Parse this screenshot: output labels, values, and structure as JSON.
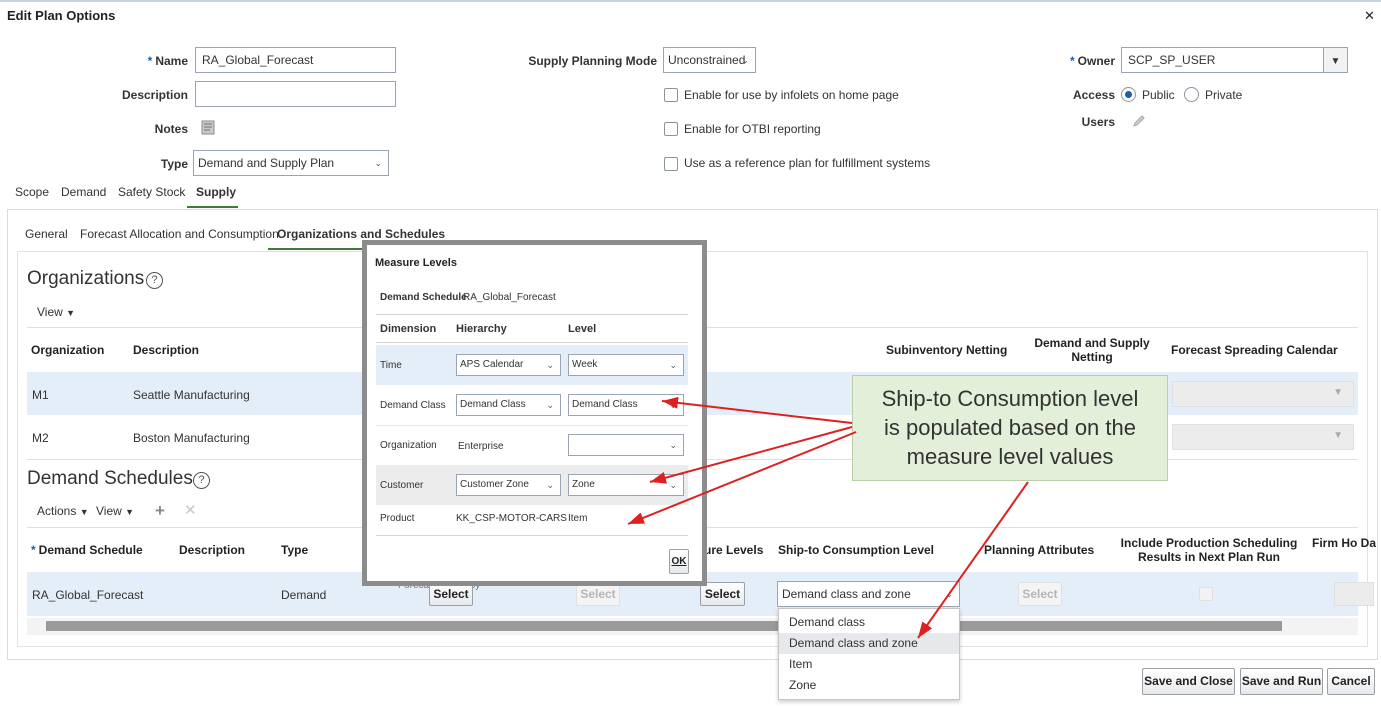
{
  "dialog": {
    "title": "Edit Plan Options",
    "close_glyph": "✕"
  },
  "form": {
    "name_label": "Name",
    "name_value": "RA_Global_Forecast",
    "description_label": "Description",
    "description_value": "",
    "notes_label": "Notes",
    "type_label": "Type",
    "type_value": "Demand and Supply Plan",
    "supply_mode_label": "Supply Planning Mode",
    "supply_mode_value": "Unconstrained",
    "check_infolets": "Enable for use by infolets on home page",
    "check_otbi": "Enable for OTBI reporting",
    "check_reference": "Use as a reference plan for fulfillment systems",
    "owner_label": "Owner",
    "owner_value": "SCP_SP_USER",
    "access_label": "Access",
    "access_public": "Public",
    "access_private": "Private",
    "access_selected": "Public",
    "users_label": "Users",
    "required_marker": "*"
  },
  "main_tabs": [
    "Scope",
    "Demand",
    "Safety Stock",
    "Supply"
  ],
  "sub_tabs": [
    "General",
    "Forecast Allocation and Consumption",
    "Organizations and Schedules"
  ],
  "organizations": {
    "title": "Organizations",
    "view_label": "View",
    "columns": {
      "organization": "Organization",
      "description": "Description",
      "subinventory": "Subinventory Netting",
      "ds_netting": "Demand and Supply Netting",
      "spreading": "Forecast Spreading Calendar"
    },
    "rows": [
      {
        "org": "M1",
        "desc": "Seattle Manufacturing"
      },
      {
        "org": "M2",
        "desc": "Boston Manufacturing"
      }
    ]
  },
  "schedules": {
    "title": "Demand Schedules",
    "actions_label": "Actions",
    "view_label": "View",
    "columns": {
      "schedule": "Demand Schedule",
      "description": "Description",
      "type": "Type",
      "measure_levels": "ure Levels",
      "ship_to": "Ship-to Consumption Level",
      "planning_attrs": "Planning Attributes",
      "include_prod": "Include Production Scheduling Results in Next Plan Run",
      "firm_ho": "Firm Ho Da"
    },
    "row": {
      "name": "RA_Global_Forecast",
      "type": "Demand",
      "fa_hint": "Forecast Accuracy",
      "select_label": "Select",
      "ship_to_value": "Demand class and zone"
    },
    "dropdown_options": [
      "Demand class",
      "Demand class and zone",
      "Item",
      "Zone"
    ],
    "dropdown_highlight": "Demand class and zone"
  },
  "measure_levels": {
    "title": "Measure Levels",
    "schedule_label": "Demand Schedule",
    "schedule_value": "RA_Global_Forecast",
    "col_dimension": "Dimension",
    "col_hierarchy": "Hierarchy",
    "col_level": "Level",
    "rows": [
      {
        "dimension": "Time",
        "hierarchy": "APS Calendar",
        "level": "Week"
      },
      {
        "dimension": "Demand Class",
        "hierarchy": "Demand Class",
        "level": "Demand Class"
      },
      {
        "dimension": "Organization",
        "hierarchy": "Enterprise",
        "level": ""
      },
      {
        "dimension": "Customer",
        "hierarchy": "Customer Zone",
        "level": "Zone"
      },
      {
        "dimension": "Product",
        "hierarchy": "KK_CSP-MOTOR-CARS",
        "level": "Item"
      }
    ],
    "ok_label": "OK"
  },
  "callout": {
    "lines": [
      "Ship-to Consumption level",
      "is populated based on the",
      "measure level values"
    ],
    "arrow_color": "#e02020",
    "bg_color": "#e3efd9"
  },
  "footer": {
    "save_close": "Save and Close",
    "save_run": "Save and Run",
    "cancel": "Cancel"
  },
  "colors": {
    "accent": "#1a5ea8",
    "tab_underline": "#3f7a36",
    "selected_row": "#e4eef8"
  }
}
